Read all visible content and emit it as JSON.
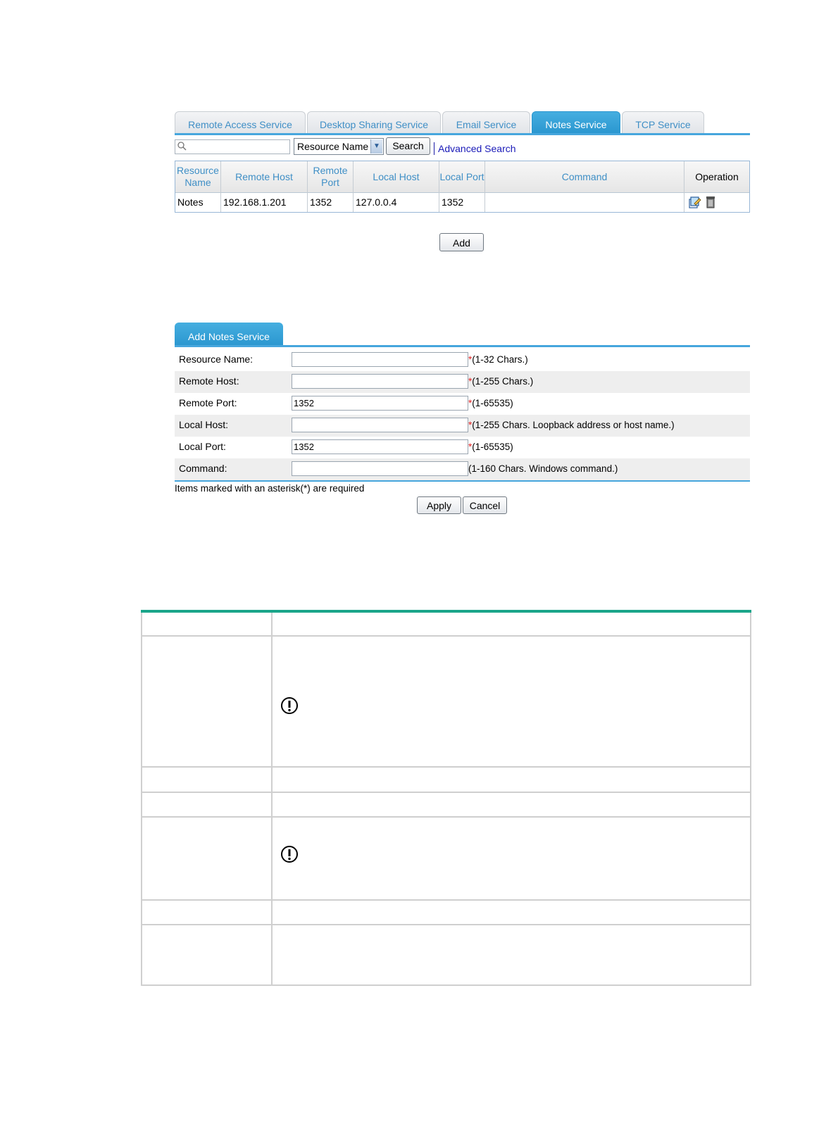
{
  "tabs": [
    {
      "label": "Remote Access Service",
      "active": false
    },
    {
      "label": "Desktop Sharing Service",
      "active": false
    },
    {
      "label": "Email Service",
      "active": false
    },
    {
      "label": "Notes Service",
      "active": true
    },
    {
      "label": "TCP Service",
      "active": false
    }
  ],
  "search": {
    "input_value": "",
    "field_selected": "Resource Name",
    "search_label": "Search",
    "advanced_label": "Advanced Search"
  },
  "resource_table": {
    "headers": [
      "Resource Name",
      "Remote Host",
      "Remote Port",
      "Local Host",
      "Local Port",
      "Command",
      "Operation"
    ],
    "rows": [
      {
        "resource_name": "Notes",
        "remote_host": "192.168.1.201",
        "remote_port": "1352",
        "local_host": "127.0.0.4",
        "local_port": "1352",
        "command": ""
      }
    ]
  },
  "add_label": "Add",
  "form": {
    "tab_label": "Add Notes Service",
    "fields": [
      {
        "label": "Resource Name:",
        "value": "",
        "required": "*",
        "hint": "(1-32 Chars.)"
      },
      {
        "label": "Remote Host:",
        "value": "",
        "required": "*",
        "hint": "(1-255 Chars.)"
      },
      {
        "label": "Remote Port:",
        "value": "1352",
        "required": "*",
        "hint": "(1-65535)"
      },
      {
        "label": "Local Host:",
        "value": "",
        "required": "*",
        "hint": "(1-255 Chars. Loopback address or host name.)"
      },
      {
        "label": "Local Port:",
        "value": "1352",
        "required": "*",
        "hint": "(1-65535)"
      },
      {
        "label": "Command:",
        "value": "",
        "required": "",
        "hint": "(1-160 Chars. Windows command.)"
      }
    ],
    "note": "Items marked with an asterisk(*) are required",
    "apply_label": "Apply",
    "cancel_label": "Cancel"
  },
  "colors": {
    "accent": "#2a96cf",
    "link": "#1a1ab8",
    "required": "#e02020",
    "doc_rule": "#1aa58a"
  }
}
